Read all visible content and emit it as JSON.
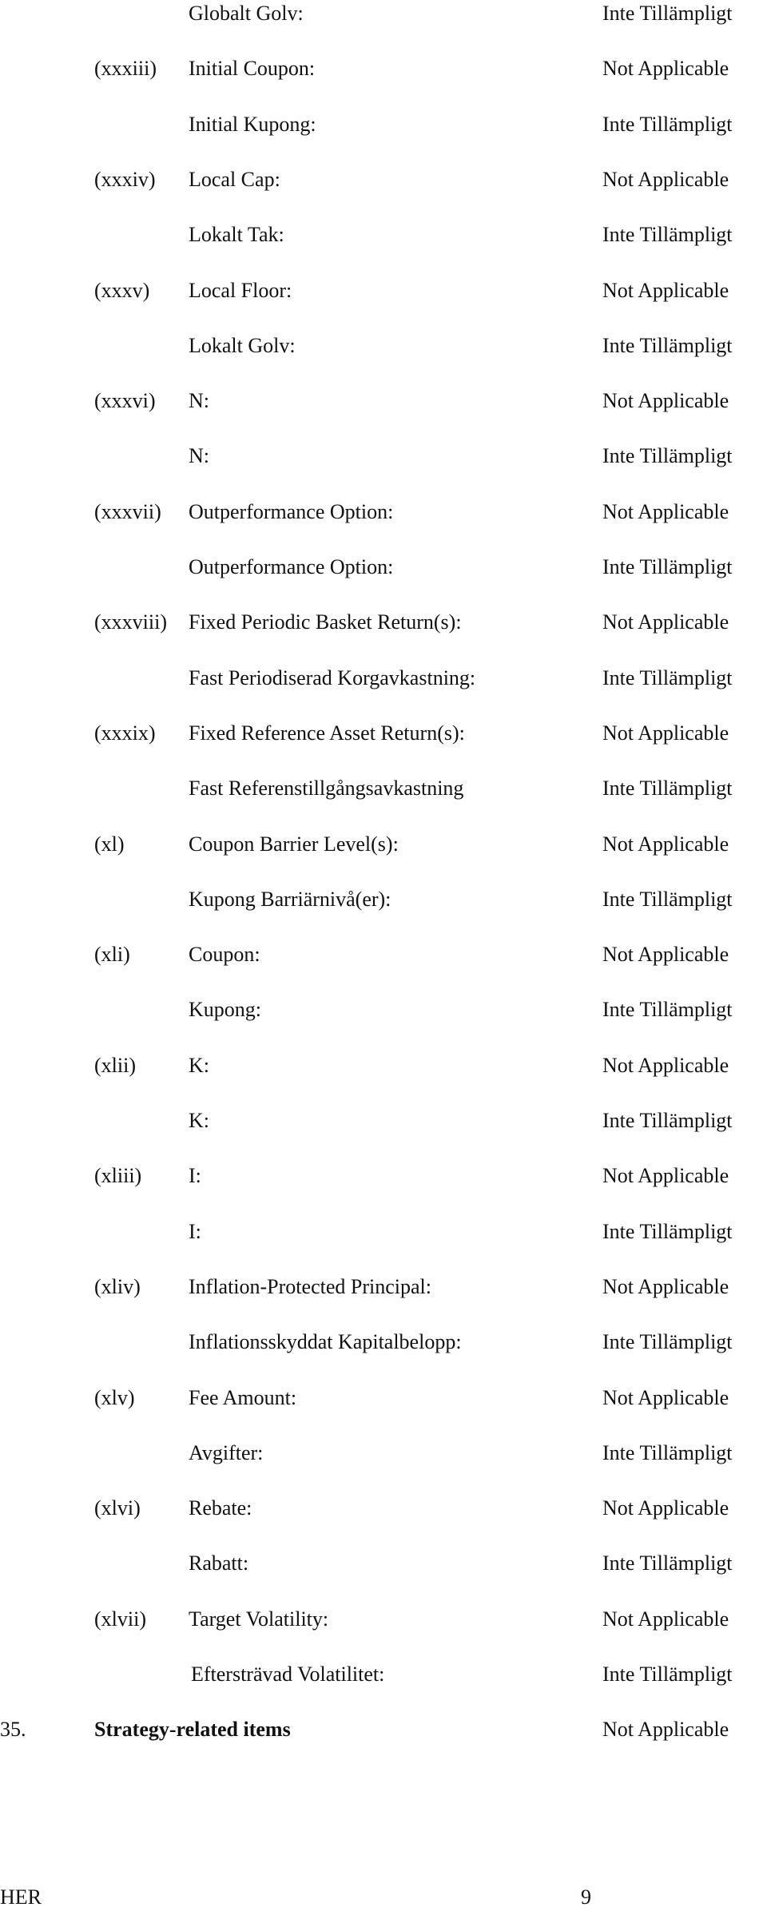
{
  "rows": [
    {
      "num": "",
      "label": "Globalt Golv:",
      "value": "Inte Tillämpligt"
    },
    {
      "num": "(xxxiii)",
      "label": "Initial Coupon:",
      "value": "Not Applicable"
    },
    {
      "num": "",
      "label": "Initial Kupong:",
      "value": "Inte Tillämpligt"
    },
    {
      "num": "(xxxiv)",
      "label": "Local Cap:",
      "value": "Not Applicable"
    },
    {
      "num": "",
      "label": "Lokalt Tak:",
      "value": "Inte Tillämpligt"
    },
    {
      "num": "(xxxv)",
      "label": "Local Floor:",
      "value": "Not Applicable"
    },
    {
      "num": "",
      "label": "Lokalt Golv:",
      "value": "Inte Tillämpligt"
    },
    {
      "num": "(xxxvi)",
      "label": "N:",
      "value": "Not Applicable"
    },
    {
      "num": "",
      "label": "N:",
      "value": "Inte Tillämpligt"
    },
    {
      "num": "(xxxvii)",
      "label": "Outperformance Option:",
      "value": "Not Applicable"
    },
    {
      "num": "",
      "label": "Outperformance Option:",
      "value": "Inte Tillämpligt"
    },
    {
      "num": "(xxxviii)",
      "label": "Fixed Periodic Basket Return(s):",
      "value": "Not Applicable"
    },
    {
      "num": "",
      "label": "Fast Periodiserad Korgavkastning:",
      "value": "Inte Tillämpligt"
    },
    {
      "num": "(xxxix)",
      "label": "Fixed Reference Asset Return(s):",
      "value": "Not Applicable"
    },
    {
      "num": "",
      "label": "Fast Referenstillgångsavkastning",
      "value": "Inte Tillämpligt"
    },
    {
      "num": "(xl)",
      "label": "Coupon Barrier Level(s):",
      "value": "Not Applicable"
    },
    {
      "num": "",
      "label": "Kupong Barriärnivå(er):",
      "value": "Inte Tillämpligt"
    },
    {
      "num": "(xli)",
      "label": "Coupon:",
      "value": "Not Applicable"
    },
    {
      "num": "",
      "label": "Kupong:",
      "value": "Inte Tillämpligt"
    },
    {
      "num": "(xlii)",
      "label": "K:",
      "value": "Not Applicable"
    },
    {
      "num": "",
      "label": "K:",
      "value": "Inte Tillämpligt"
    },
    {
      "num": "(xliii)",
      "label": "I:",
      "value": "Not Applicable"
    },
    {
      "num": "",
      "label": "I:",
      "value": "Inte Tillämpligt"
    },
    {
      "num": "(xliv)",
      "label": "Inflation-Protected Principal:",
      "value": "Not Applicable"
    },
    {
      "num": "",
      "label": "Inflationsskyddat Kapitalbelopp:",
      "value": "Inte Tillämpligt"
    },
    {
      "num": "(xlv)",
      "label": "Fee Amount:",
      "value": "Not Applicable"
    },
    {
      "num": "",
      "label": "Avgifter:",
      "value": "Inte Tillämpligt"
    },
    {
      "num": "(xlvi)",
      "label": "Rebate:",
      "value": "Not Applicable"
    },
    {
      "num": "",
      "label": "Rabatt:",
      "value": "Inte Tillämpligt"
    },
    {
      "num": "(xlvii)",
      "label": "Target Volatility:",
      "value": "Not Applicable"
    },
    {
      "num": "",
      "label": "Eftersträvad Volatilitet:",
      "value": "Inte Tillämpligt"
    }
  ],
  "section": {
    "num": "35.",
    "title": "Strategy-related items",
    "value": "Not Applicable"
  },
  "footer": {
    "left": "HER",
    "page": "9"
  }
}
